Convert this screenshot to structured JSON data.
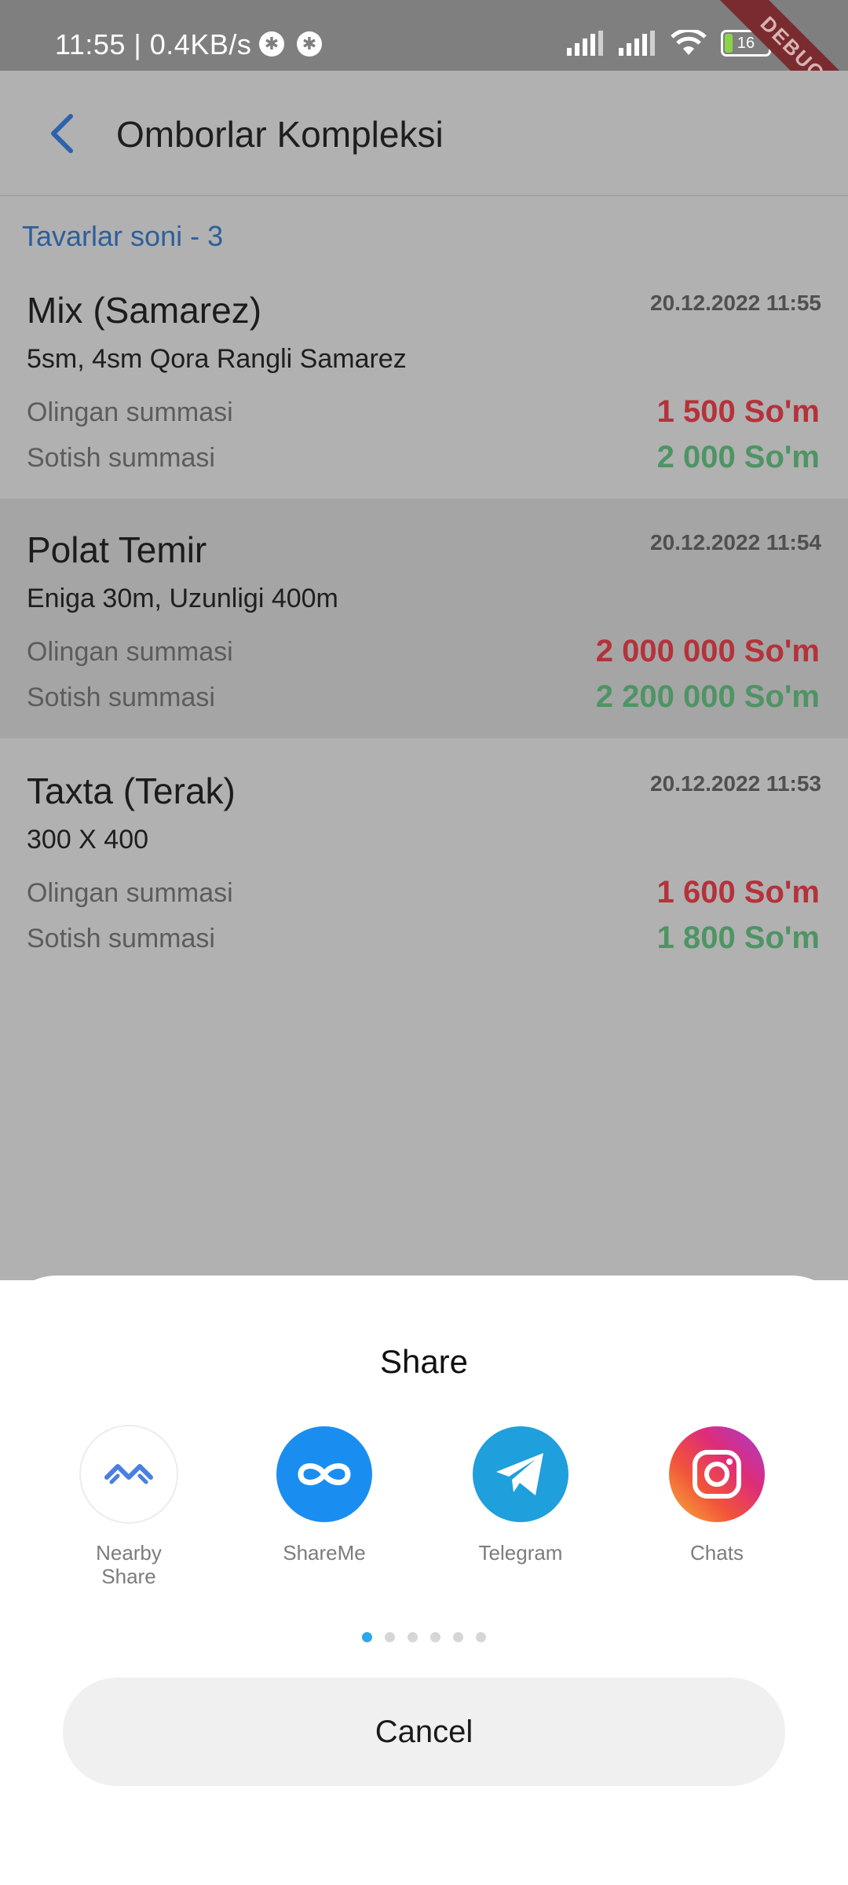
{
  "status_bar": {
    "time_speed": "11:55 | 0.4KB/s",
    "battery_level": "16",
    "debug_banner": "DEBUG"
  },
  "app_bar": {
    "title": "Omborlar Kompleksi",
    "back_icon": "chevron-left-icon"
  },
  "summary": {
    "count_label": "Tavarlar soni - 3"
  },
  "items": [
    {
      "title": "Mix (Samarez)",
      "date": "20.12.2022 11:55",
      "description": "5sm, 4sm Qora Rangli Samarez",
      "buy_label": "Olingan summasi",
      "buy_value": "1 500 So'm",
      "sell_label": "Sotish summasi",
      "sell_value": "2 000 So'm"
    },
    {
      "title": "Polat Temir",
      "date": "20.12.2022 11:54",
      "description": "Eniga 30m, Uzunligi 400m",
      "buy_label": "Olingan summasi",
      "buy_value": "2 000 000 So'm",
      "sell_label": "Sotish summasi",
      "sell_value": "2 200 000 So'm"
    },
    {
      "title": "Taxta (Terak)",
      "date": "20.12.2022 11:53",
      "description": "300 X 400",
      "buy_label": "Olingan summasi",
      "buy_value": "1 600 So'm",
      "sell_label": "Sotish summasi",
      "sell_value": "1 800 So'm"
    }
  ],
  "share_sheet": {
    "title": "Share",
    "apps": [
      {
        "label": "Nearby Share",
        "icon": "nearby-share-icon"
      },
      {
        "label": "ShareMe",
        "icon": "shareme-icon"
      },
      {
        "label": "Telegram",
        "icon": "telegram-icon"
      },
      {
        "label": "Chats",
        "icon": "instagram-icon"
      }
    ],
    "page_count": 6,
    "active_page": 1,
    "cancel_label": "Cancel"
  },
  "colors": {
    "accent_blue": "#2d5f9a",
    "buy_red": "#b5323a",
    "sell_green": "#4e9464",
    "scrim": "#b1b1b1"
  }
}
